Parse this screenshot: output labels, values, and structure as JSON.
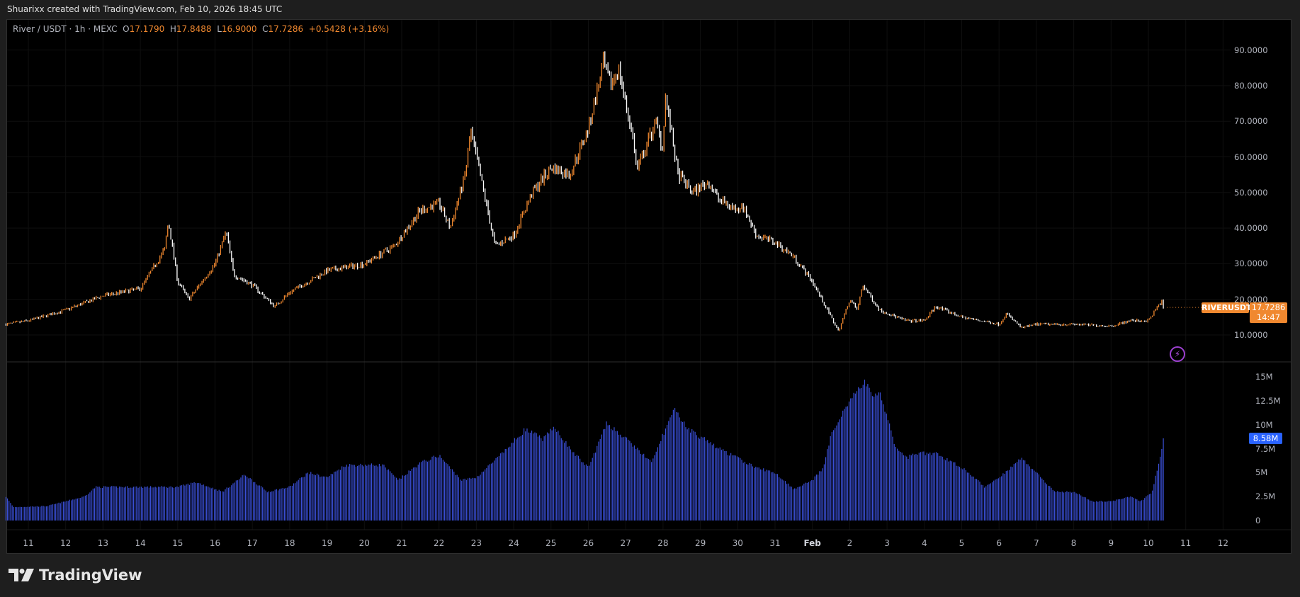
{
  "header": {
    "caption": "Shuarixx created with TradingView.com, Feb 10, 2026 18:45 UTC"
  },
  "legend": {
    "symbol": "River / USDT · 1h · MEXC",
    "o_label": "O",
    "o": "17.1790",
    "h_label": "H",
    "h": "17.8488",
    "l_label": "L",
    "l": "16.9000",
    "c_label": "C",
    "c": "17.7286",
    "change": "+0.5428 (+3.16%)"
  },
  "price_axis": [
    "90.0000",
    "80.0000",
    "70.0000",
    "60.0000",
    "50.0000",
    "40.0000",
    "30.0000",
    "20.0000",
    "10.0000"
  ],
  "volume_axis": [
    "15M",
    "12.5M",
    "10M",
    "7.5M",
    "5M",
    "2.5M",
    "0"
  ],
  "time_axis": [
    "11",
    "12",
    "13",
    "14",
    "15",
    "16",
    "17",
    "18",
    "19",
    "20",
    "21",
    "22",
    "23",
    "24",
    "25",
    "26",
    "27",
    "28",
    "29",
    "30",
    "31",
    "Feb",
    "2",
    "3",
    "4",
    "5",
    "6",
    "7",
    "8",
    "9",
    "10",
    "11",
    "12"
  ],
  "symbol_label": "RIVERUSDT",
  "last_price": "17.7286",
  "countdown": "14:47",
  "last_volume": "8.58M",
  "logo_text": "TradingView",
  "colors": {
    "up": "#f0882f",
    "down": "#ffffff",
    "volume": "#3a4fd6",
    "volume_badge": "#2962ff"
  },
  "chart_data": {
    "type": "candlestick",
    "interval": "1h",
    "x_unit": "days since Jan 11 00:00",
    "ylim": [
      5,
      95
    ],
    "volume_ylim": [
      0,
      15.5
    ],
    "last_price": 17.7286,
    "price_path": [
      [
        -0.6,
        13
      ],
      [
        0,
        14
      ],
      [
        1,
        17
      ],
      [
        2,
        21
      ],
      [
        3,
        23
      ],
      [
        3.65,
        34
      ],
      [
        3.75,
        42
      ],
      [
        4,
        25
      ],
      [
        4.3,
        20
      ],
      [
        5,
        30
      ],
      [
        5.3,
        39
      ],
      [
        5.5,
        27
      ],
      [
        6,
        24
      ],
      [
        6.6,
        18
      ],
      [
        7,
        22
      ],
      [
        8,
        28
      ],
      [
        9,
        30
      ],
      [
        9.8,
        35
      ],
      [
        10.5,
        45
      ],
      [
        11,
        47
      ],
      [
        11.3,
        40
      ],
      [
        11.7,
        55
      ],
      [
        11.85,
        67
      ],
      [
        12.2,
        50
      ],
      [
        12.5,
        35
      ],
      [
        13,
        38
      ],
      [
        13.5,
        50
      ],
      [
        14,
        57
      ],
      [
        14.5,
        55
      ],
      [
        15,
        68
      ],
      [
        15.4,
        86
      ],
      [
        15.6,
        80
      ],
      [
        15.8,
        85
      ],
      [
        16.2,
        65
      ],
      [
        16.3,
        56
      ],
      [
        16.8,
        70
      ],
      [
        17,
        62
      ],
      [
        17.05,
        78
      ],
      [
        17.4,
        55
      ],
      [
        17.8,
        50
      ],
      [
        18.2,
        53
      ],
      [
        18.5,
        48
      ],
      [
        19,
        45
      ],
      [
        19.1,
        47
      ],
      [
        19.5,
        38
      ],
      [
        20,
        36
      ],
      [
        20.5,
        32
      ],
      [
        21,
        25
      ],
      [
        21.5,
        15
      ],
      [
        21.7,
        11
      ],
      [
        22,
        20
      ],
      [
        22.2,
        17
      ],
      [
        22.35,
        24
      ],
      [
        22.8,
        17
      ],
      [
        23.5,
        14
      ],
      [
        24,
        14
      ],
      [
        24.3,
        18
      ],
      [
        25,
        15
      ],
      [
        26,
        13
      ],
      [
        26.2,
        16
      ],
      [
        26.6,
        12
      ],
      [
        27,
        13
      ],
      [
        28,
        13
      ],
      [
        29,
        12.5
      ],
      [
        29.5,
        14
      ],
      [
        30,
        14
      ],
      [
        30.25,
        18
      ],
      [
        30.35,
        19.5
      ],
      [
        30.42,
        17.73
      ]
    ],
    "volume_path_millions": [
      [
        -0.6,
        2.5
      ],
      [
        -0.4,
        1.4
      ],
      [
        0.5,
        1.5
      ],
      [
        1.5,
        2.5
      ],
      [
        1.8,
        3.5
      ],
      [
        4,
        3.5
      ],
      [
        4.5,
        4
      ],
      [
        5.2,
        3
      ],
      [
        5.8,
        4.8
      ],
      [
        6.4,
        3
      ],
      [
        7,
        3.5
      ],
      [
        7.5,
        5
      ],
      [
        8,
        4.5
      ],
      [
        8.5,
        5.8
      ],
      [
        9.5,
        5.8
      ],
      [
        9.9,
        4.2
      ],
      [
        10.5,
        6
      ],
      [
        11,
        6.8
      ],
      [
        11.6,
        4.2
      ],
      [
        12,
        4.5
      ],
      [
        12.7,
        7
      ],
      [
        13.3,
        9.5
      ],
      [
        13.8,
        8.5
      ],
      [
        14.1,
        9.8
      ],
      [
        14.5,
        7.5
      ],
      [
        15,
        5.5
      ],
      [
        15.5,
        10.2
      ],
      [
        16.3,
        7.5
      ],
      [
        16.7,
        6
      ],
      [
        17,
        9
      ],
      [
        17.3,
        11.5
      ],
      [
        17.7,
        9.5
      ],
      [
        18.5,
        7.5
      ],
      [
        19,
        6.5
      ],
      [
        19.5,
        5.5
      ],
      [
        20,
        5
      ],
      [
        20.5,
        3.3
      ],
      [
        21,
        4.2
      ],
      [
        21.3,
        5.5
      ],
      [
        21.5,
        9
      ],
      [
        21.9,
        12
      ],
      [
        22.1,
        13
      ],
      [
        22.4,
        14.5
      ],
      [
        22.6,
        13
      ],
      [
        22.8,
        13.5
      ],
      [
        23.2,
        8
      ],
      [
        23.5,
        6.5
      ],
      [
        23.8,
        7
      ],
      [
        24.3,
        7
      ],
      [
        24.8,
        6
      ],
      [
        25.2,
        5
      ],
      [
        25.6,
        3.5
      ],
      [
        26,
        4.5
      ],
      [
        26.6,
        6.5
      ],
      [
        27,
        5
      ],
      [
        27.5,
        3
      ],
      [
        28,
        3
      ],
      [
        28.5,
        2
      ],
      [
        29,
        2
      ],
      [
        29.5,
        2.5
      ],
      [
        29.8,
        2
      ],
      [
        30.1,
        3
      ],
      [
        30.42,
        8.58
      ]
    ]
  }
}
